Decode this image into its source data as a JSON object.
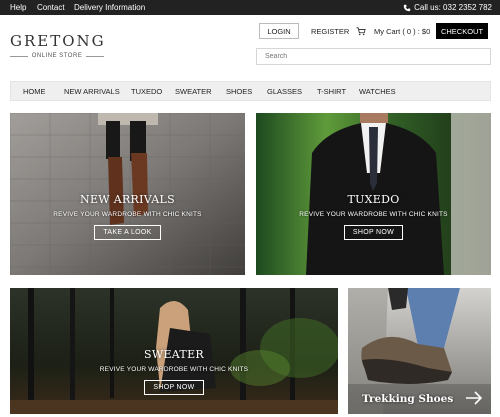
{
  "topbar": {
    "help": "Help",
    "contact": "Contact",
    "delivery": "Delivery Information",
    "phone": "Call us: 032 2352 782"
  },
  "brand": {
    "name": "GRETONG",
    "tagline": "ONLINE STORE"
  },
  "header": {
    "login": "LOGIN",
    "register": "REGISTER",
    "cart": "My Cart ( 0 ) : $0",
    "checkout": "CHECKOUT",
    "search_placeholder": "Search"
  },
  "nav": {
    "items": [
      "HOME",
      "NEW ARRIVALS",
      "TUXEDO",
      "SWEATER",
      "SHOES",
      "GLASSES",
      "T-SHIRT",
      "WATCHES"
    ]
  },
  "banners": [
    {
      "title": "NEW ARRIVALS",
      "subtitle": "REVIVE YOUR WARDROBE WITH CHIC KNITS",
      "button": "TAKE A LOOK"
    },
    {
      "title": "TUXEDO",
      "subtitle": "REVIVE YOUR WARDROBE WITH CHIC KNITS",
      "button": "SHOP NOW"
    },
    {
      "title": "SWEATER",
      "subtitle": "REVIVE YOUR WARDROBE WITH CHIC KNITS",
      "button": "SHOP NOW"
    },
    {
      "title": "Trekking Shoes"
    }
  ],
  "colors": {
    "topbar": "#222222",
    "checkout": "#000000",
    "nav_bg": "#efefef"
  }
}
